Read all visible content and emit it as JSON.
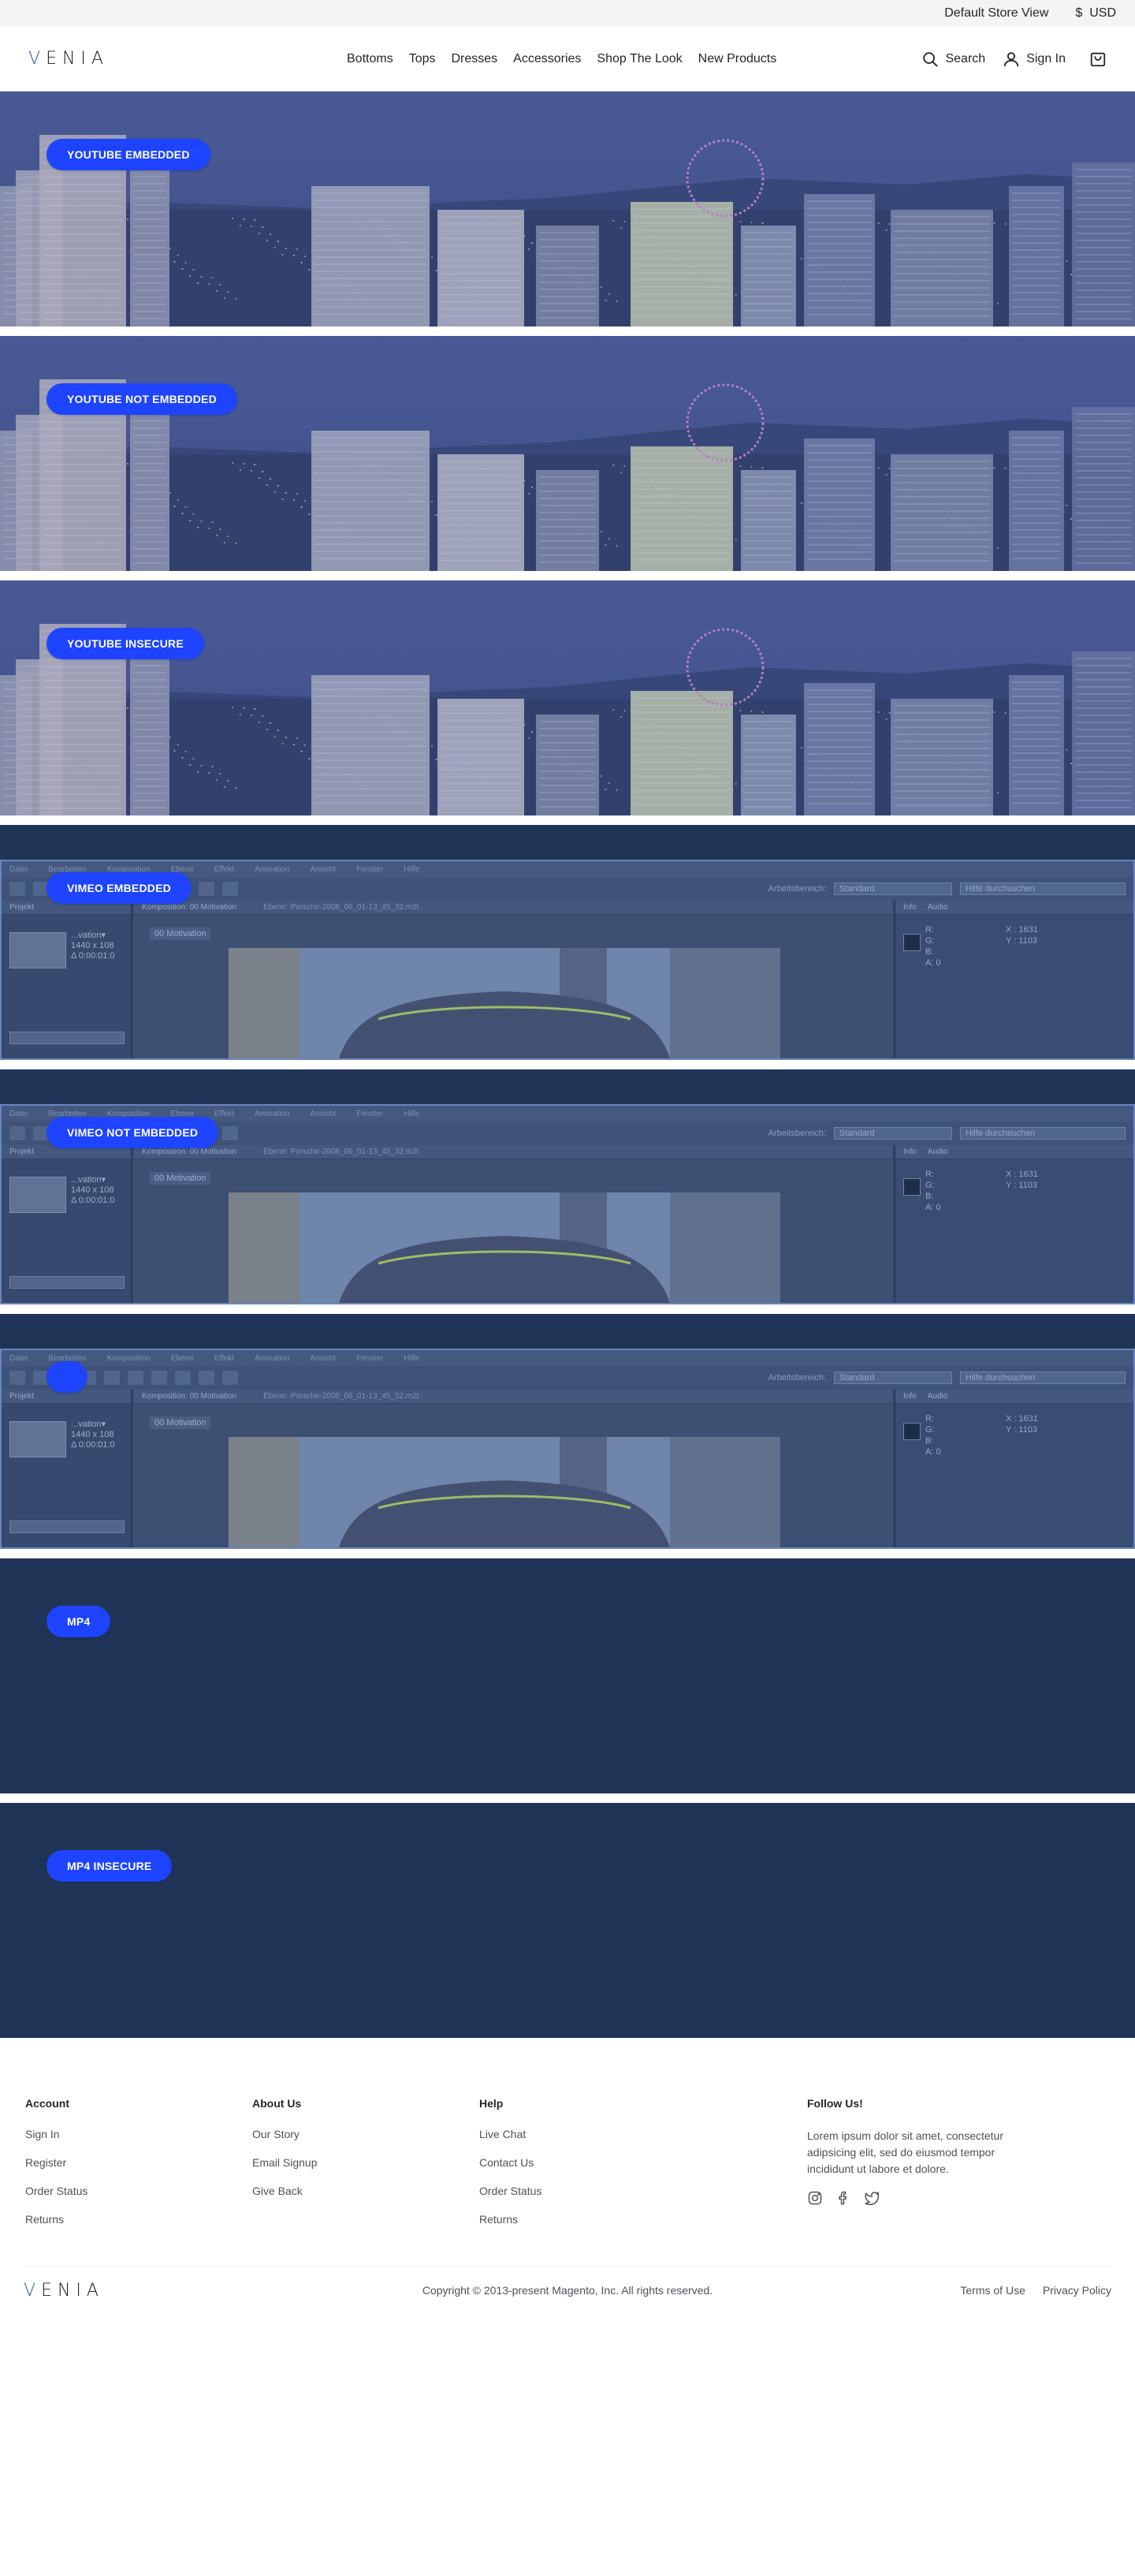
{
  "utility": {
    "store_view": "Default Store View",
    "currency": "USD",
    "currency_symbol": "$"
  },
  "header": {
    "logo": "VENIA",
    "nav": [
      "Bottoms",
      "Tops",
      "Dresses",
      "Accessories",
      "Shop The Look",
      "New Products"
    ],
    "search_label": "Search",
    "signin_label": "Sign In"
  },
  "banners": [
    {
      "label": "YOUTUBE EMBEDDED",
      "media": "city-skyline-image"
    },
    {
      "label": "YOUTUBE NOT EMBEDDED",
      "media": "city-skyline-image"
    },
    {
      "label": "YOUTUBE INSECURE",
      "media": "city-skyline-image"
    },
    {
      "label": "VIMEO EMBEDDED",
      "media": "video-editor-screenshot"
    },
    {
      "label": "VIMEO NOT EMBEDDED",
      "media": "video-editor-screenshot"
    },
    {
      "label": "",
      "media": "video-editor-screenshot"
    },
    {
      "label": "MP4",
      "media": "none"
    },
    {
      "label": "MP4 INSECURE",
      "media": "none"
    }
  ],
  "editor": {
    "menu": [
      "Datei",
      "Bearbeiten",
      "Komposition",
      "Ebene",
      "Effekt",
      "Animation",
      "Ansicht",
      "Fenster",
      "Hilfe"
    ],
    "workspace_label": "Arbeitsbereich:",
    "workspace_value": "Standard",
    "help_search": "Hilfe durchsuchen",
    "project_tab": "Projekt",
    "comp_tab": "Komposition: 00 Motivation",
    "layer_tab": "Ebene: Porsche-2008_06_01-13_45_32.m2t",
    "comp_name": "00 Motivation",
    "thumb_lines": [
      "...vation▾",
      "1440 x 108",
      "Δ 0:00:01:0"
    ],
    "info_tab": "Info",
    "audio_tab": "Audio",
    "rgb_lines": [
      "R:",
      "G:",
      "B:",
      "A: 0"
    ],
    "xy_lines": [
      "X : 1631",
      "Y : 1103"
    ]
  },
  "footer": {
    "columns": [
      {
        "title": "Account",
        "links": [
          "Sign In",
          "Register",
          "Order Status",
          "Returns"
        ]
      },
      {
        "title": "About Us",
        "links": [
          "Our Story",
          "Email Signup",
          "Give Back"
        ]
      },
      {
        "title": "Help",
        "links": [
          "Live Chat",
          "Contact Us",
          "Order Status",
          "Returns"
        ]
      }
    ],
    "follow_title": "Follow Us!",
    "follow_text": "Lorem ipsum dolor sit amet, consectetur adipsicing elit, sed do eiusmod tempor incididunt ut labore et dolore.",
    "social_icons": [
      "instagram-icon",
      "facebook-icon",
      "twitter-icon"
    ],
    "copyright": "Copyright © 2013-present Magento, Inc. All rights reserved.",
    "terms": "Terms of Use",
    "privacy": "Privacy Policy"
  },
  "colors": {
    "pill": "#1e44ff",
    "banner_bg": "#203457",
    "logo_accent": "#2d52b8"
  }
}
